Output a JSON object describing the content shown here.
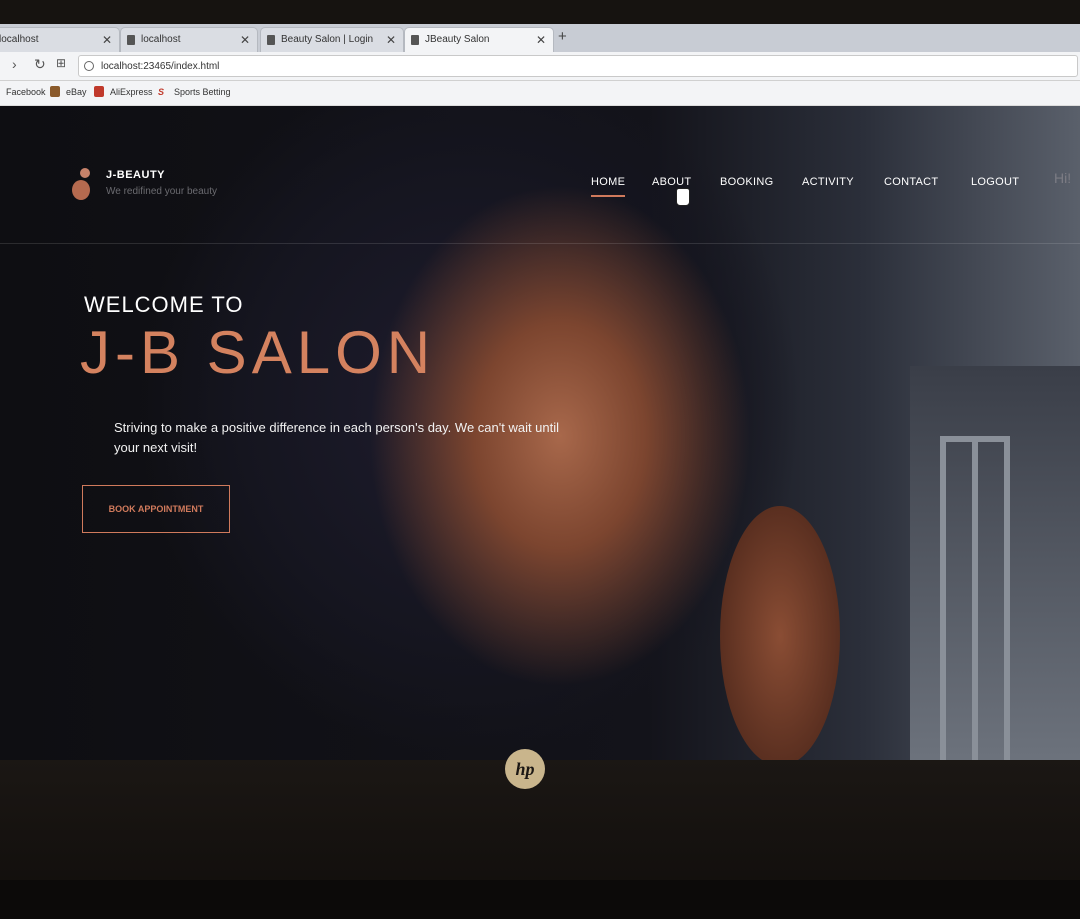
{
  "browser": {
    "tabs": [
      {
        "label": "localhost",
        "active": false
      },
      {
        "label": "localhost",
        "active": false
      },
      {
        "label": "Beauty Salon | Login",
        "active": false
      },
      {
        "label": "JBeauty Salon",
        "active": true
      }
    ],
    "url": "localhost:23465/index.html",
    "bookmarks": [
      "Facebook",
      "eBay",
      "AliExpress",
      "Sports Betting"
    ]
  },
  "site": {
    "brand": "J-BEAUTY",
    "tagline": "We redifined your beauty",
    "nav": [
      "HOME",
      "ABOUT",
      "BOOKING",
      "ACTIVITY",
      "CONTACT",
      "LOGOUT"
    ],
    "active_nav": "HOME",
    "greeting": "Hi!",
    "hero": {
      "welcome": "WELCOME TO",
      "title": "J-B SALON",
      "description": "Striving to make a positive difference in each person's day. We can't wait until your next visit!",
      "cta": "BOOK APPOINTMENT"
    },
    "accent": "#d07a5c"
  },
  "laptop": {
    "logo": "hp"
  }
}
